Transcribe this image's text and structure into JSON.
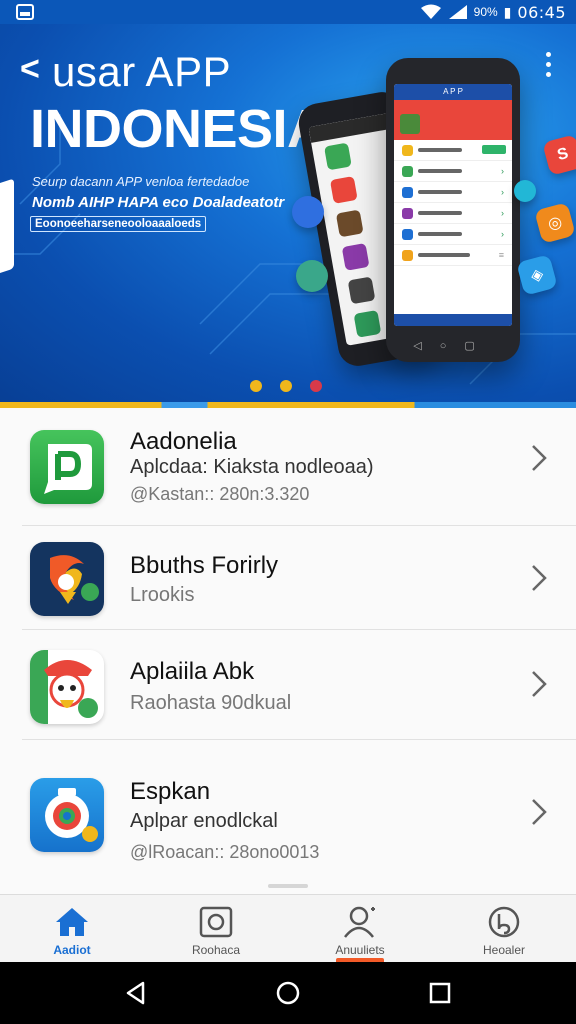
{
  "status_bar": {
    "network": "90%",
    "time": "06:45"
  },
  "banner": {
    "back_glyph": "<",
    "title_line1": "usar APP",
    "title_line2": "INDONESIA",
    "subtitle1": "Seurp dacann APP venloa fertedadoe",
    "subtitle2": "Nomb AIHP HAPA eco Doaladeatotr",
    "tag": "Eoonoeeharseneooloaaaloeds",
    "phone_title": "A P P",
    "carousel_count": 3,
    "carousel_dot_colors": [
      "#f0b71c",
      "#f0b71c",
      "#d83a4a"
    ],
    "active_index": 0
  },
  "apps": [
    {
      "name": "Aadonelia",
      "subtitle": "Aplcdaa: Kiaksta nodleoaa)",
      "meta": "@Kastan:: 280n:3.320"
    },
    {
      "name": "Bbuths Forirly",
      "subtitle": "Lrookis",
      "meta": ""
    },
    {
      "name": "Aplaiila Abk",
      "subtitle": "Raohasta 90dkual",
      "meta": ""
    },
    {
      "name": "Espkan",
      "subtitle": "Aplpar enodlckal",
      "meta": "@lRoacan:: 28ono0013"
    }
  ],
  "tabs": [
    {
      "label": "Aadiot",
      "icon": "home-icon",
      "active": true
    },
    {
      "label": "Roohaca",
      "icon": "camera-icon",
      "active": false
    },
    {
      "label": "Anuuliets",
      "icon": "user-icon",
      "active": false
    },
    {
      "label": "Heoaler",
      "icon": "profile-icon",
      "active": false
    }
  ],
  "colors": {
    "accent": "#1a6fd3",
    "banner": "#0b57b8",
    "indicator": "#f25a28"
  }
}
